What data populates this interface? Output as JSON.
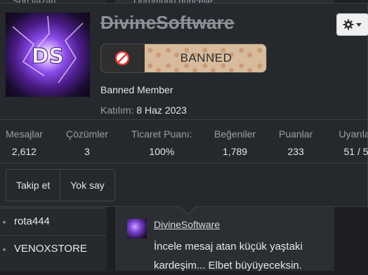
{
  "background": {
    "left_top_label": "Son yazan",
    "right_top_label": "Durumunu güncelle",
    "list": [
      "rota444",
      "VENOXSTORE"
    ],
    "message": {
      "user": "DivineSoftware",
      "text": "İncele mesaj atan küçük yaştaki kardeşim... Elbet büyüyeceksin."
    }
  },
  "profile": {
    "username": "DivineSoftware",
    "banner_label": "BANNED",
    "member_title": "Banned Member",
    "joined_label": "Katılım:",
    "joined_date": "8 Haz 2023",
    "avatar_text": "DS",
    "gear_menu_icon": "gear-icon",
    "ban_icon": "no-entry-icon"
  },
  "stats": [
    {
      "label": "Mesajlar",
      "value": "2,612"
    },
    {
      "label": "Çözümler",
      "value": "3"
    },
    {
      "label": "Ticaret Puanı:",
      "value": "100%"
    },
    {
      "label": "Beğeniler",
      "value": "1,789"
    },
    {
      "label": "Puanlar",
      "value": "233"
    },
    {
      "label": "Uyarılar",
      "value": "51 / 5"
    }
  ],
  "actions": {
    "follow": "Takip et",
    "ignore": "Yok say"
  }
}
